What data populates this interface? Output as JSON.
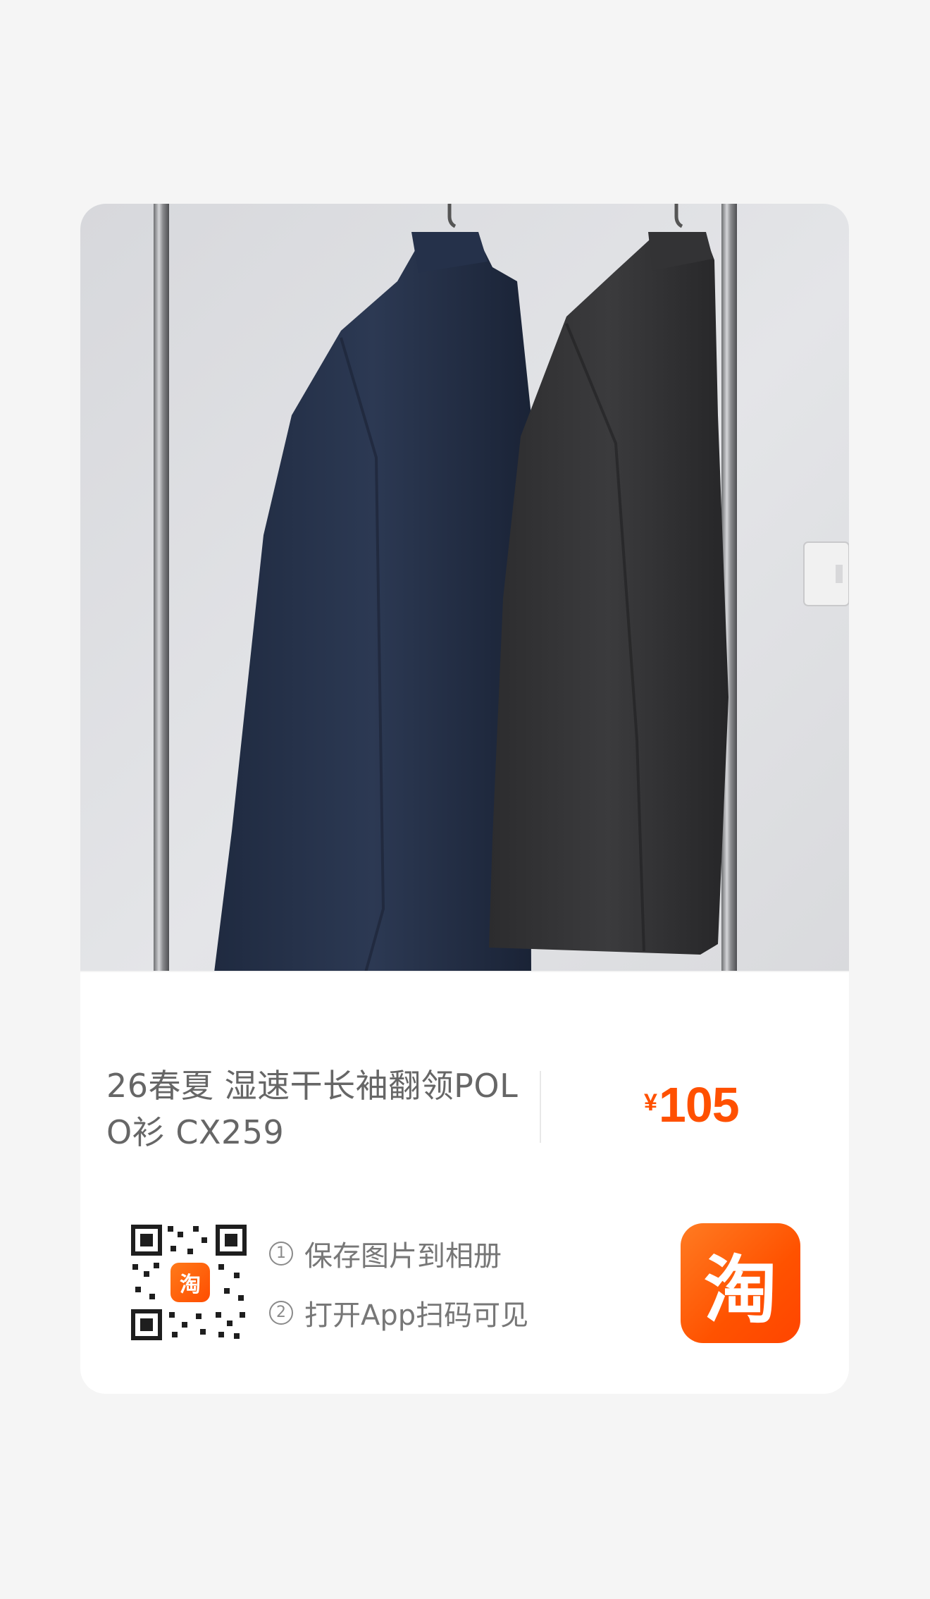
{
  "product": {
    "title": "26春夏 湿速干长袖翻领POLO衫 CX259",
    "image_icon": "photo-of-two-long-sleeve-polo-shirts-on-rack",
    "price_symbol": "¥",
    "price_value": "105"
  },
  "instructions": {
    "step1_number": "①",
    "step1_text": "保存图片到相册",
    "step2_number": "②",
    "step2_text": "打开App扫码可见"
  },
  "qr": {
    "badge_text": "淘"
  },
  "logo": {
    "text": "淘",
    "icon": "taobao-app-icon"
  },
  "colors": {
    "accent": "#ff5000",
    "card_bg": "#ffffff",
    "page_bg": "#f5f5f5",
    "text": "#666666"
  }
}
